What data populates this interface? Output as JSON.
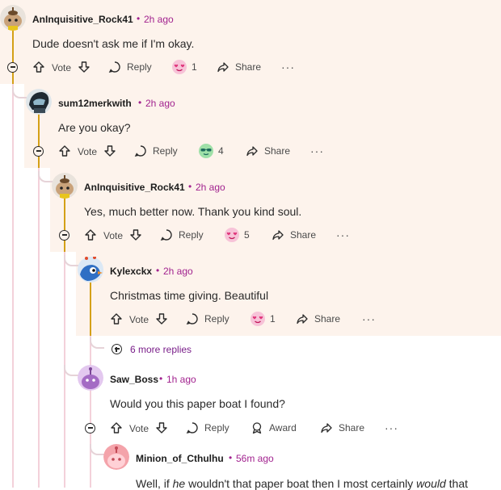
{
  "labels": {
    "vote": "Vote",
    "reply": "Reply",
    "share": "Share",
    "award": "Award",
    "separator": "•",
    "more": "···"
  },
  "colors": {
    "band": "#fdf3ec",
    "thread_line": "#f0c8d2",
    "highlight_line": "#d4a017",
    "meta": "#a2238f"
  },
  "comments": [
    {
      "author": "AnInquisitive_Rock41",
      "time": "2h ago",
      "body": "Dude doesn't ask me if I'm okay.",
      "reaction_count": "1",
      "avatar": "snoo-acorn-avatar"
    },
    {
      "author": "sum12merkwith",
      "time": "2h ago",
      "body": "Are you okay?",
      "reaction_count": "4",
      "avatar": "snoo-helmet-avatar"
    },
    {
      "author": "AnInquisitive_Rock41",
      "time": "2h ago",
      "body": "Yes, much better now. Thank you kind soul.",
      "reaction_count": "5",
      "avatar": "snoo-acorn-avatar"
    },
    {
      "author": "Kylexckx",
      "time": "2h ago",
      "body": "Christmas time giving. Beautiful",
      "reaction_count": "1",
      "avatar": "snoo-bird-avatar"
    },
    {
      "author": "Saw_Boss",
      "time": "1h ago",
      "body": "Would you this paper boat I found?",
      "avatar": "snoo-purple-avatar"
    },
    {
      "author": "Minion_of_Cthulhu",
      "time": "56m ago",
      "body_parts": [
        "Well, if ",
        "he",
        " wouldn't that paper boat then I most certainly ",
        "would",
        " that"
      ],
      "avatar": "snoo-pink-avatar"
    }
  ],
  "more_replies": "6 more replies"
}
